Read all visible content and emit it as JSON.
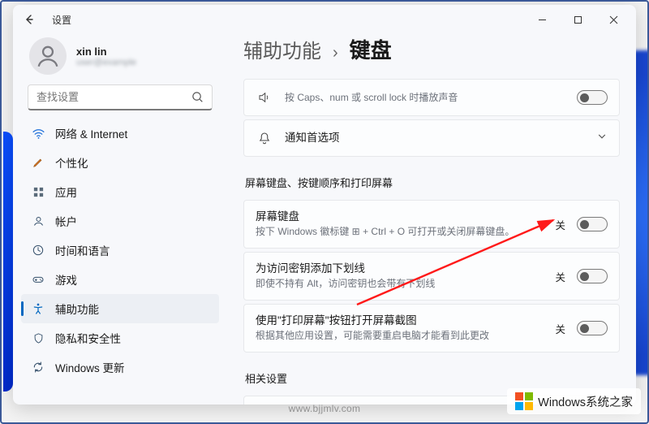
{
  "window": {
    "title": "设置"
  },
  "profile": {
    "name": "xin lin",
    "sub": "user@example"
  },
  "search": {
    "placeholder": "查找设置"
  },
  "sidebar": {
    "items": [
      {
        "label": "网络 & Internet",
        "icon": "wifi"
      },
      {
        "label": "个性化",
        "icon": "brush"
      },
      {
        "label": "应用",
        "icon": "apps"
      },
      {
        "label": "帐户",
        "icon": "user"
      },
      {
        "label": "时间和语言",
        "icon": "clock"
      },
      {
        "label": "游戏",
        "icon": "game"
      },
      {
        "label": "辅助功能",
        "icon": "access"
      },
      {
        "label": "隐私和安全性",
        "icon": "shield"
      },
      {
        "label": "Windows 更新",
        "icon": "update"
      }
    ]
  },
  "breadcrumb": {
    "parent": "辅助功能",
    "current": "键盘"
  },
  "top_cards": {
    "toggle_keys_sub": "按 Caps、num 或 scroll lock 时播放声音",
    "notify_title": "通知首选项"
  },
  "section1": {
    "heading": "屏幕键盘、按键顺序和打印屏幕",
    "card1": {
      "title": "屏幕键盘",
      "sub": "按下 Windows 徽标键 ⊞ + Ctrl + O 可打开或关闭屏幕键盘。",
      "state": "关"
    },
    "card2": {
      "title": "为访问密钥添加下划线",
      "sub": "即使不持有 Alt，访问密钥也会带有下划线",
      "state": "关"
    },
    "card3": {
      "title": "使用\"打印屏幕\"按钮打开屏幕截图",
      "sub": "根据其他应用设置，可能需要重启电脑才能看到此更改",
      "state": "关"
    }
  },
  "section2": {
    "heading": "相关设置"
  },
  "watermark": "www.bjjmlv.com",
  "brand": "Windows系统之家"
}
